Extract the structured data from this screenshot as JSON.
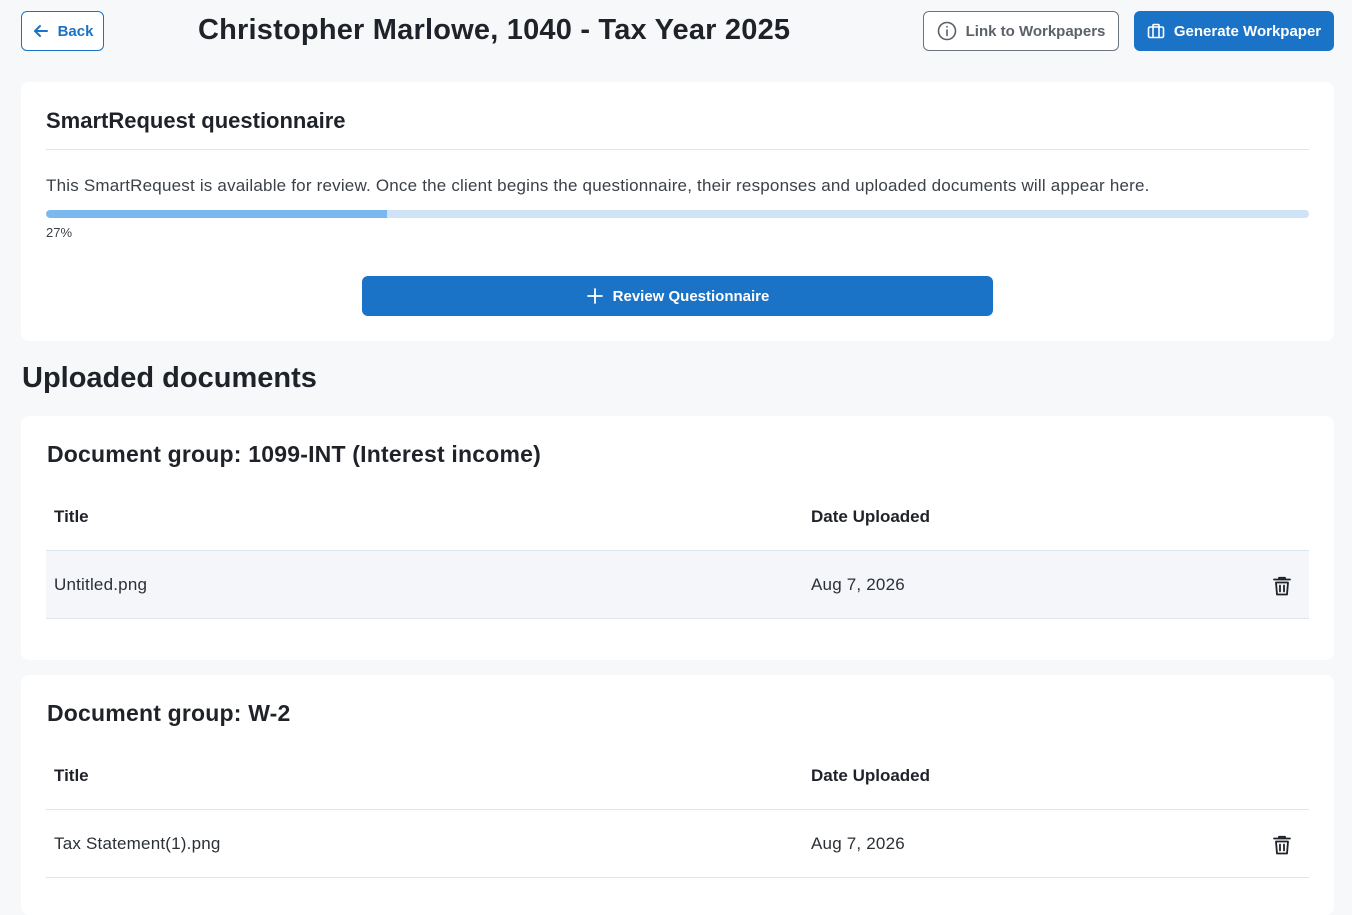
{
  "header": {
    "back_label": "Back",
    "title": "Christopher Marlowe, 1040 - Tax Year 2025",
    "link_label": "Link to Workpapers",
    "generate_label": "Generate Workpaper"
  },
  "smart_request": {
    "title": "SmartRequest questionnaire",
    "description": "This SmartRequest is available for review. Once the client begins the questionnaire, their responses and uploaded documents will appear here.",
    "progress_percent": 27,
    "progress_label": "27%",
    "review_label": "Review Questionnaire"
  },
  "uploaded": {
    "heading": "Uploaded documents",
    "columns": {
      "title": "Title",
      "date": "Date Uploaded"
    },
    "groups": [
      {
        "title": "Document group: 1099-INT (Interest income)",
        "rows": [
          {
            "title": "Untitled.png",
            "date": "Aug 7, 2026"
          }
        ]
      },
      {
        "title": "Document group: W-2",
        "rows": [
          {
            "title": "Tax Statement(1).png",
            "date": "Aug 7, 2026"
          }
        ]
      }
    ]
  },
  "colors": {
    "accent": "#1a73c6",
    "progress_fill": "#7cb8f0",
    "progress_track": "#cfe3f7"
  },
  "icons": {
    "back": "arrow-left-icon",
    "link": "info-circle-icon",
    "generate": "briefcase-icon",
    "review": "plus-icon",
    "delete": "trash-icon"
  }
}
